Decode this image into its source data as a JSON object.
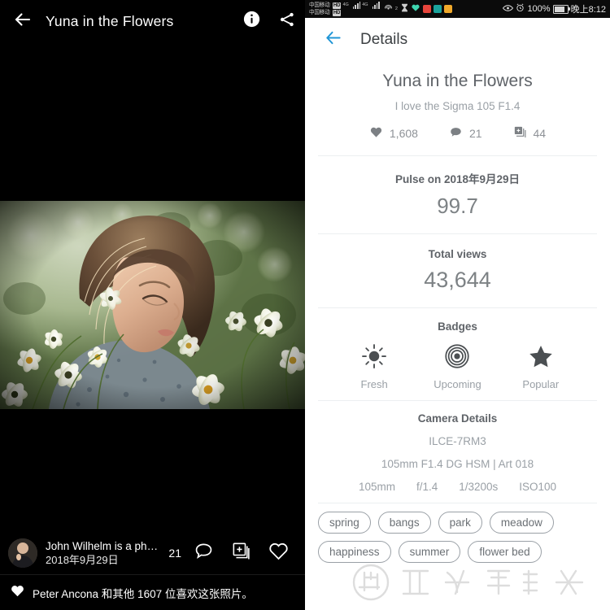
{
  "photo_viewer": {
    "back_icon": "arrow-left-icon",
    "title": "Yuna in the Flowers",
    "info_icon": "info-icon",
    "share_icon": "share-icon",
    "author_name": "John Wilhelm is a pho...",
    "author_date": "2018年9月29日",
    "comment_count": "21",
    "comment_icon": "comment-icon",
    "add_icon": "add-to-album-icon",
    "like_icon": "heart-outline-icon",
    "like_line_icon": "heart-filled-icon",
    "like_line_text": "Peter Ancona 和其他 1607 位喜欢这张照片。"
  },
  "status_bar": {
    "carrier_1": "中国移动",
    "carrier_2": "中国移动",
    "hd_badge": "HD",
    "network_1": "4G",
    "network_2": "4G",
    "hotspot_icon": "hotspot-icon",
    "hotspot_sup": "2",
    "hourglass_icon": "hourglass-icon",
    "heart_app_icon": "heart-app-icon",
    "app_icons": [
      "play-app-icon",
      "camera-app-icon",
      "folder-app-icon"
    ],
    "app_colors": [
      "#e8453c",
      "#1ba39c",
      "#f0a92b"
    ],
    "eye_icon": "eye-icon",
    "alarm_icon": "alarm-clock-icon",
    "battery_percent": "100%",
    "battery_icon": "battery-icon",
    "time": "晚上8:12"
  },
  "details": {
    "back_icon": "arrow-left-icon",
    "back_color": "#2196d6",
    "header_title": "Details",
    "title": "Yuna in the Flowers",
    "subtitle": "I love the Sigma 105 F1.4",
    "stats": [
      {
        "icon": "heart-filled-icon",
        "value": "1,608"
      },
      {
        "icon": "comment-filled-icon",
        "value": "21"
      },
      {
        "icon": "add-to-album-icon",
        "value": "44"
      }
    ],
    "pulse": {
      "label": "Pulse on 2018年9月29日",
      "value": "99.7"
    },
    "views": {
      "label": "Total views",
      "value": "43,644"
    },
    "badges": {
      "title": "Badges",
      "items": [
        {
          "icon": "sun-icon",
          "label": "Fresh"
        },
        {
          "icon": "concentric-circles-icon",
          "label": "Upcoming"
        },
        {
          "icon": "star-icon",
          "label": "Popular"
        }
      ]
    },
    "camera": {
      "title": "Camera Details",
      "body": "ILCE-7RM3",
      "lens": "105mm F1.4 DG HSM | Art 018",
      "exif": [
        "105mm",
        "f/1.4",
        "1/3200s",
        "ISO100"
      ]
    },
    "tags": [
      "spring",
      "bangs",
      "park",
      "meadow",
      "happiness",
      "summer",
      "flower bed"
    ]
  }
}
